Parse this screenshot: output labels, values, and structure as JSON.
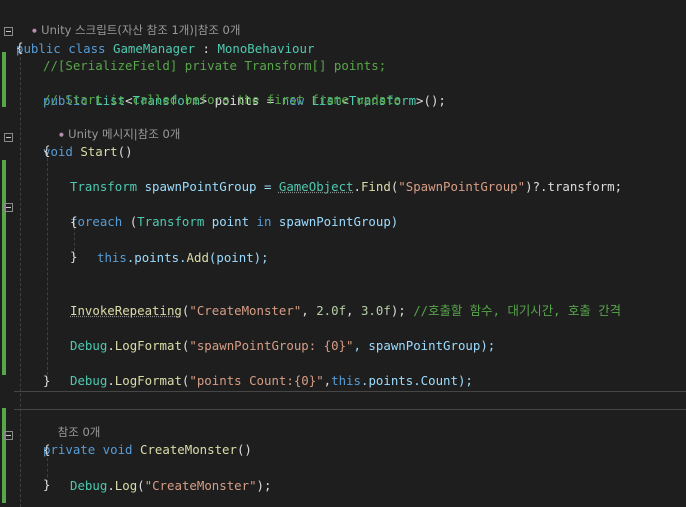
{
  "lens": {
    "class_refs": "Unity 스크립트(자산 참조 1개)|참조 0개",
    "start_refs": "Unity 메시지|참조 0개",
    "create_refs": "참조 0개"
  },
  "code": {
    "l1_kw": "public class ",
    "l1_type": "GameManager",
    "l1_sep": " : ",
    "l1_base": "MonoBehaviour",
    "l2": "{",
    "l3": "//[SerializeField] private Transform[] points;",
    "l4_kw": "public ",
    "l4_t1": "List",
    "l4_p1": "<",
    "l4_t2": "Transform",
    "l4_p2": "> points = ",
    "l4_kw2": "new ",
    "l4_t3": "List",
    "l4_p3": "<",
    "l4_t4": "Transform",
    "l4_p4": ">();",
    "l5": "// Start is called before the first frame update",
    "l6_kw": "void ",
    "l6_m": "Start",
    "l6_p": "()",
    "l7": "{",
    "l8_t": "Transform",
    "l8_v": " spawnPointGroup = ",
    "l8_t2": "GameObject",
    "l8_p": ".",
    "l8_m": "Find",
    "l8_p2": "(",
    "l8_s": "\"SpawnPointGroup\"",
    "l8_p3": ")?.transform;",
    "l9_kw": "foreach ",
    "l9_p": "(",
    "l9_t": "Transform",
    "l9_v": " point ",
    "l9_kw2": "in",
    "l9_v2": " spawnPointGroup)",
    "l10": "{",
    "l11_kw": "this",
    "l11_p": ".points.",
    "l11_m": "Add",
    "l11_p2": "(point);",
    "l12": "}",
    "l13_m": "InvokeRepeating",
    "l13_p": "(",
    "l13_s": "\"CreateMonster\"",
    "l13_p2": ", ",
    "l13_n1": "2.0f",
    "l13_p3": ", ",
    "l13_n2": "3.0f",
    "l13_p4": "); ",
    "l13_c": "//호출할 함수, 대기시간, 호출 간격",
    "l14_t": "Debug",
    "l14_p": ".",
    "l14_m": "LogFormat",
    "l14_p2": "(",
    "l14_s": "\"spawnPointGroup: {0}\"",
    "l14_p3": ", spawnPointGroup);",
    "l15_t": "Debug",
    "l15_p": ".",
    "l15_m": "LogFormat",
    "l15_p2": "(",
    "l15_s": "\"points Count:{0}\"",
    "l15_p3": ",",
    "l15_kw": "this",
    "l15_p4": ".points.Count);",
    "l16": "}",
    "l17_kw": "private void ",
    "l17_m": "CreateMonster",
    "l17_p": "()",
    "l18": "{",
    "l19_t": "Debug",
    "l19_p": ".",
    "l19_m": "Log",
    "l19_p2": "(",
    "l19_s": "\"CreateMonster\"",
    "l19_p3": ");",
    "l20": "}"
  },
  "colors": {
    "background": "#1e1e1e",
    "keyword": "#569cd6",
    "type": "#4ec9b0",
    "comment": "#57a64a",
    "string": "#d69d85",
    "number": "#b5cea8",
    "method": "#dcdcaa",
    "changebar": "#57a64a"
  },
  "icons": {
    "unity": "unity-icon",
    "fold": "collapse-minus-icon"
  }
}
